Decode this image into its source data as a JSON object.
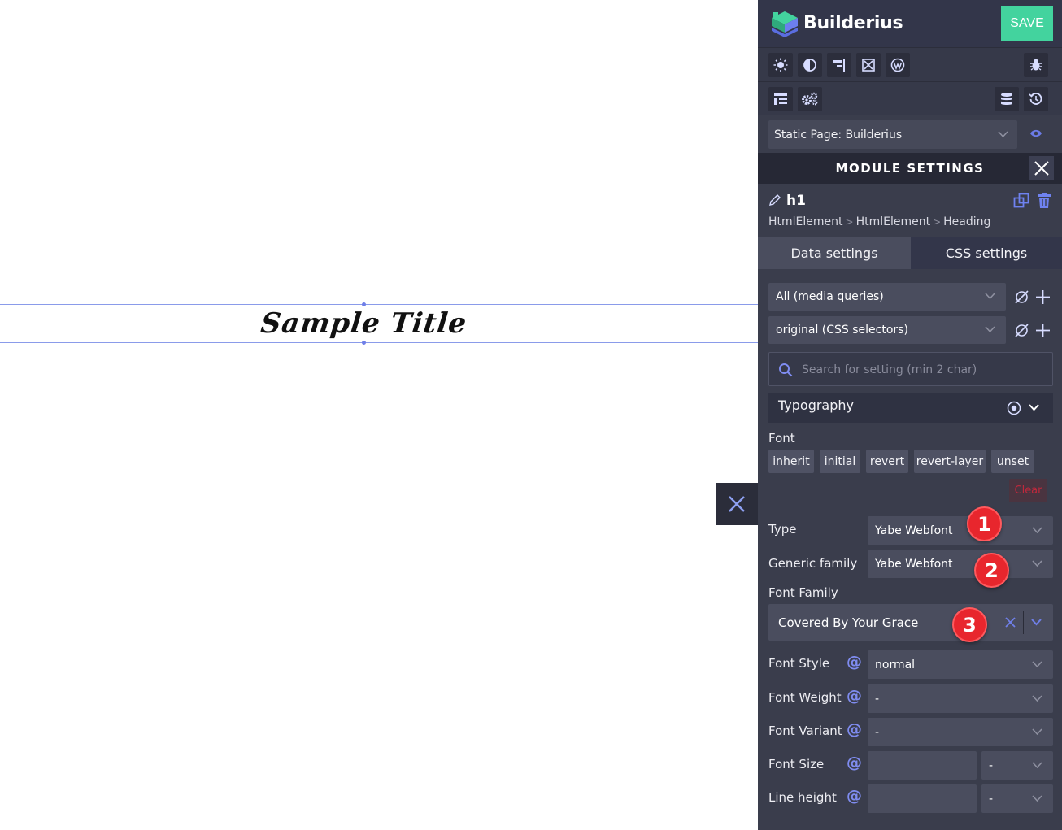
{
  "canvas": {
    "sample_title": "Sample Title"
  },
  "header": {
    "brand": "Builderius",
    "save_label": "SAVE"
  },
  "page_select": {
    "value": "Static Page: Builderius"
  },
  "module": {
    "title": "MODULE SETTINGS",
    "element_name": "h1",
    "breadcrumbs": [
      "HtmlElement",
      "HtmlElement",
      "Heading"
    ],
    "breadcrumb_sep": ">"
  },
  "tabs": {
    "data": "Data settings",
    "css": "CSS settings"
  },
  "css": {
    "media_query": "All (media queries)",
    "selector": "original (CSS selectors)",
    "search_placeholder": "Search for setting (min 2 char)",
    "section": "Typography",
    "font_label": "Font",
    "font_chips": [
      "inherit",
      "initial",
      "revert",
      "revert-layer",
      "unset"
    ],
    "clear_label": "Clear",
    "type_label": "Type",
    "type_value": "Yabe Webfont",
    "generic_label": "Generic family",
    "generic_value": "Yabe Webfont",
    "font_family_label": "Font Family",
    "font_family_value": "Covered By Your Grace",
    "font_style_label": "Font Style",
    "font_style_value": "normal",
    "font_weight_label": "Font Weight",
    "font_weight_value": "-",
    "font_variant_label": "Font Variant",
    "font_variant_value": "-",
    "font_size_label": "Font Size",
    "font_size_unit": "-",
    "line_height_label": "Line height",
    "line_height_unit": "-",
    "at_symbol": "@"
  },
  "annotations": [
    "1",
    "2",
    "3"
  ],
  "colors": {
    "accent": "#43d39e",
    "panel": "#3a3d4c",
    "badge": "#e8262d",
    "at": "#7f8cf0"
  }
}
